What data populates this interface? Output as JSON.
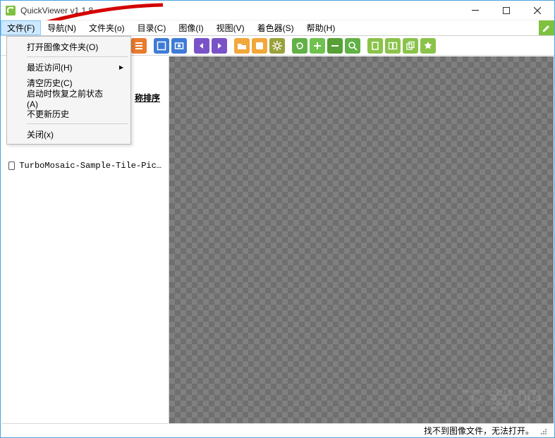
{
  "window": {
    "title": "QuickViewer v1.1.8",
    "min_tip": "Minimize",
    "max_tip": "Maximize",
    "close_tip": "Close"
  },
  "menubar": {
    "items": [
      "文件(F)",
      "导航(N)",
      "文件夹(o)",
      "目录(C)",
      "图像(I)",
      "视图(V)",
      "着色器(S)",
      "帮助(H)"
    ],
    "active_index": 0
  },
  "file_menu": {
    "open_folder": "打开图像文件夹(O)",
    "recent": "最近访问(H)",
    "clear_history": "清空历史(C)",
    "restore_state": "启动时恢复之前状态(A)",
    "no_update_history": "不更新历史",
    "close": "关闭(x)"
  },
  "toolbar_icons": [
    "folder-image-icon",
    "nav-prev-icon",
    "nav-next-icon",
    "list-icon",
    "fit-window-icon",
    "fit-width-icon",
    "page-first-icon",
    "page-last-icon",
    "open-folder-icon",
    "book-icon",
    "gear-icon",
    "refresh-icon",
    "zoom-in-icon",
    "zoom-out-icon",
    "zoom-fit-icon",
    "single-page-icon",
    "dual-page-icon",
    "clone-icon",
    "bookmark-icon"
  ],
  "sidebar": {
    "sort_label": "称排序",
    "file_name": "TurboMosaic-Sample-Tile-Pic…"
  },
  "canvas": {
    "watermark": "下载吧"
  },
  "statusbar": {
    "message": "找不到图像文件，无法打开。"
  }
}
